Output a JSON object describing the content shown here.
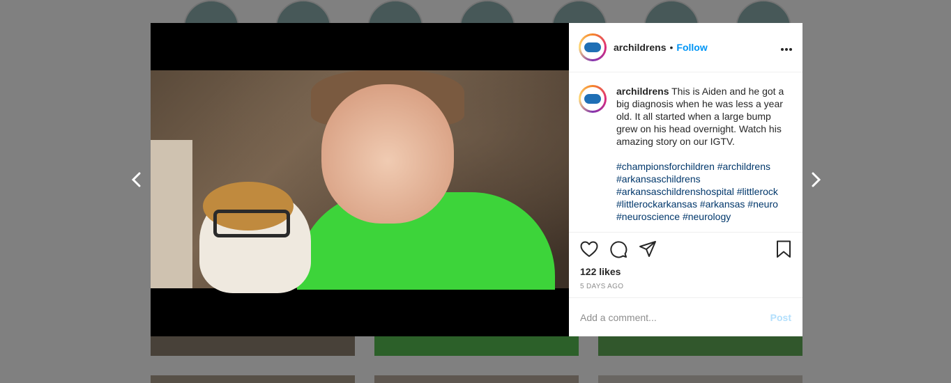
{
  "post": {
    "username": "archildrens",
    "separator": "•",
    "follow_label": "Follow",
    "more_label": "•••",
    "caption": "This is Aiden and he got a big diagnosis when he was less a year old. It all started when a large bump grew on his head overnight. Watch his amazing story on our IGTV.",
    "hashtags": "#championsforchildren #archildrens #arkansaschildrens #arkansaschildrenshospital #littlerock #littlerockarkansas #arkansas #neuro #neuroscience #neurology",
    "likes": "122 likes",
    "time_ago": "5 DAYS AGO",
    "comment_placeholder": "Add a comment...",
    "post_label": "Post"
  },
  "icons": {
    "prev": "chevron-left-icon",
    "next": "chevron-right-icon",
    "like": "heart-icon",
    "comment": "comment-icon",
    "share": "paper-plane-icon",
    "save": "bookmark-icon"
  },
  "colors": {
    "link": "#0095f6",
    "hashtag": "#00376b",
    "text": "#262626",
    "muted": "#8e8e8e",
    "post_disabled": "#b2dffc"
  }
}
